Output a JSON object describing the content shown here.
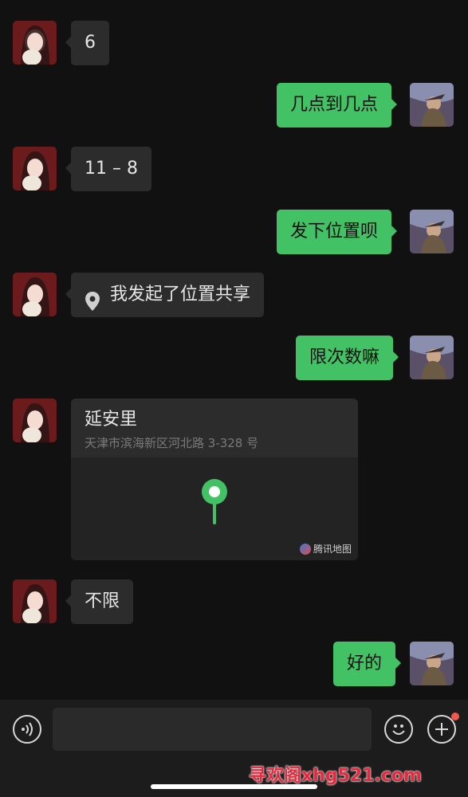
{
  "messages": [
    {
      "side": "in",
      "text": "6"
    },
    {
      "side": "out",
      "text": "几点到几点"
    },
    {
      "side": "in",
      "text": "11 – 8"
    },
    {
      "side": "out",
      "text": "发下位置呗"
    },
    {
      "side": "in",
      "type": "location-share",
      "text": "我发起了位置共享",
      "icon": "location-pin-icon"
    },
    {
      "side": "out",
      "text": "限次数嘛"
    },
    {
      "side": "in",
      "type": "location",
      "name": "延安里",
      "address": "天津市滨海新区河北路 3-328 号",
      "brand": "腾讯地图"
    },
    {
      "side": "in",
      "text": "不限"
    },
    {
      "side": "out",
      "text": "好的"
    }
  ],
  "input_bar": {
    "placeholder": "",
    "voice_icon": "voice-icon",
    "emoji_icon": "emoji-icon",
    "plus_icon": "plus-icon"
  },
  "watermark": "寻欢阁xhg521.com",
  "colors": {
    "background": "#111111",
    "incoming_bubble": "#2c2c2c",
    "outgoing_bubble": "#43c265",
    "marker": "#43c265"
  }
}
